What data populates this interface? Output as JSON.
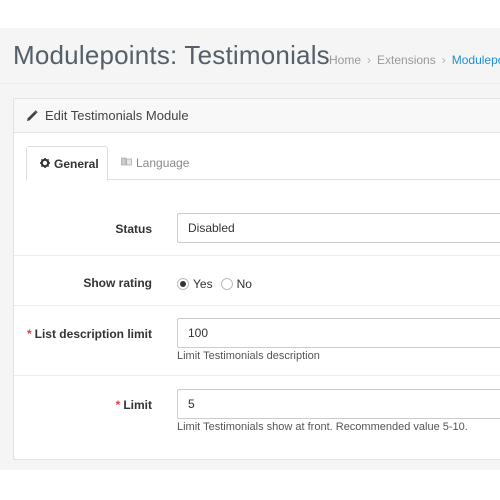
{
  "header": {
    "title": "Modulepoints: Testimonials",
    "breadcrumb": [
      {
        "label": "Home"
      },
      {
        "label": "Extensions"
      },
      {
        "label": "Modulepo"
      }
    ],
    "separator": "›"
  },
  "panel": {
    "title": "Edit Testimonials Module",
    "icon": "pencil-icon"
  },
  "tabs": [
    {
      "label": "General",
      "icon": "gear-icon",
      "active": true
    },
    {
      "label": "Language",
      "icon": "flag-icon",
      "active": false
    }
  ],
  "form": {
    "status": {
      "label": "Status",
      "value": "Disabled"
    },
    "show_rating": {
      "label": "Show rating",
      "options": [
        {
          "label": "Yes",
          "checked": true
        },
        {
          "label": "No",
          "checked": false
        }
      ]
    },
    "list_description_limit": {
      "required_marker": "*",
      "label": "List description limit",
      "value": "100",
      "help": "Limit Testimonials description"
    },
    "limit": {
      "required_marker": "*",
      "label": "Limit",
      "value": "5",
      "help": "Limit Testimonials show at front. Recommended value 5-10."
    }
  },
  "colors": {
    "link": "#1e91cf",
    "required": "#e23c3c",
    "title": "#555f69"
  }
}
